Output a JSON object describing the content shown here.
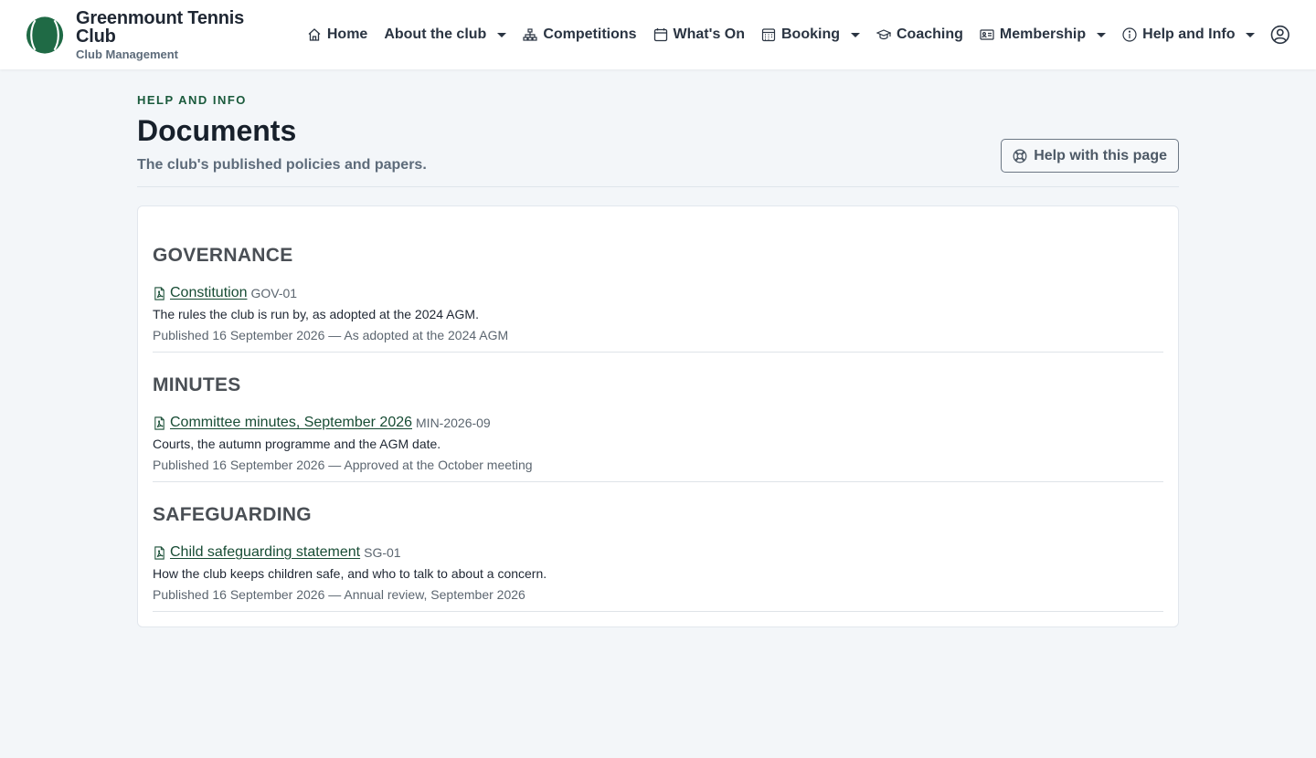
{
  "brand": {
    "name": "Greenmount Tennis Club",
    "subtitle": "Club Management",
    "color": "#1f6a45"
  },
  "nav": [
    {
      "label": "Home",
      "icon": "home-icon",
      "dropdown": false
    },
    {
      "label": "About the club",
      "icon": "",
      "dropdown": true
    },
    {
      "label": "Competitions",
      "icon": "sitemap-icon",
      "dropdown": false
    },
    {
      "label": "What's On",
      "icon": "calendar-icon",
      "dropdown": false
    },
    {
      "label": "Booking",
      "icon": "calendar-grid-icon",
      "dropdown": true
    },
    {
      "label": "Coaching",
      "icon": "graduation-cap-icon",
      "dropdown": false
    },
    {
      "label": "Membership",
      "icon": "id-card-icon",
      "dropdown": true
    },
    {
      "label": "Help and Info",
      "icon": "info-circle-icon",
      "dropdown": true
    }
  ],
  "page": {
    "eyebrow": "HELP AND INFO",
    "title": "Documents",
    "subtitle": "The club's published policies and papers.",
    "help_button": "Help with this page"
  },
  "sections": [
    {
      "title": "GOVERNANCE",
      "docs": [
        {
          "title": "Constitution",
          "code": "GOV-01",
          "description": "The rules the club is run by, as adopted at the 2024 AGM.",
          "meta": "Published 16 September 2026 — As adopted at the 2024 AGM"
        }
      ]
    },
    {
      "title": "MINUTES",
      "docs": [
        {
          "title": "Committee minutes, September 2026",
          "code": "MIN-2026-09",
          "description": "Courts, the autumn programme and the AGM date.",
          "meta": "Published 16 September 2026 — Approved at the October meeting"
        }
      ]
    },
    {
      "title": "SAFEGUARDING",
      "docs": [
        {
          "title": "Child safeguarding statement",
          "code": "SG-01",
          "description": "How the club keeps children safe, and who to talk to about a concern.",
          "meta": "Published 16 September 2026 — Annual review, September 2026"
        }
      ]
    }
  ],
  "colors": {
    "accent": "#1a5a3c",
    "link": "#174c34",
    "background": "#f3f6f9"
  }
}
